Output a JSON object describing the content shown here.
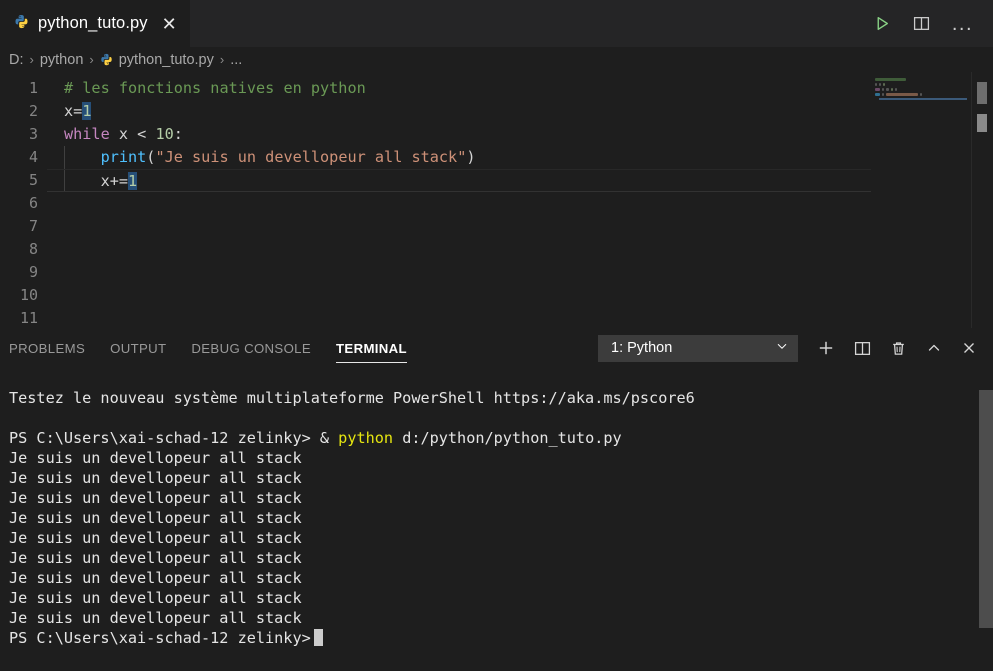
{
  "window": {
    "tab": {
      "label": "python_tuto.py",
      "icon": "python-icon",
      "close_icon": "close-icon"
    },
    "actions": [
      {
        "name": "run-python-file-button",
        "icon": "play-icon",
        "color": "#89d185"
      },
      {
        "name": "split-editor-button",
        "icon": "split-editor-icon",
        "color": "#cccccc"
      },
      {
        "name": "more-actions-button",
        "icon": "ellipsis-icon",
        "label": "..."
      }
    ]
  },
  "breadcrumb": {
    "items": [
      {
        "label": "D:",
        "icon": ""
      },
      {
        "label": "python",
        "icon": ""
      },
      {
        "label": "python_tuto.py",
        "icon": "python-icon"
      },
      {
        "label": "...",
        "icon": ""
      }
    ],
    "separator": "›"
  },
  "editor": {
    "line_numbers": [
      "1",
      "2",
      "3",
      "4",
      "5",
      "6",
      "7",
      "8",
      "9",
      "10",
      "11"
    ],
    "current_line": 5,
    "lines": [
      {
        "n": 1,
        "tokens": [
          {
            "t": "# les fonctions natives en python",
            "c": "cmt"
          }
        ]
      },
      {
        "n": 2,
        "tokens": [
          {
            "t": "x",
            "c": "pun"
          },
          {
            "t": "=",
            "c": "pun"
          },
          {
            "t": "1",
            "c": "num sel-num"
          }
        ]
      },
      {
        "n": 3,
        "tokens": [
          {
            "t": "while",
            "c": "kw"
          },
          {
            "t": " ",
            "c": "pun"
          },
          {
            "t": "x",
            "c": "pun"
          },
          {
            "t": " < ",
            "c": "pun"
          },
          {
            "t": "10",
            "c": "num"
          },
          {
            "t": ":",
            "c": "pun"
          }
        ]
      },
      {
        "n": 4,
        "tokens": [
          {
            "t": "    ",
            "c": "pun"
          },
          {
            "t": "print",
            "c": "fn"
          },
          {
            "t": "(",
            "c": "pun"
          },
          {
            "t": "\"Je suis un devellopeur all stack\"",
            "c": "str"
          },
          {
            "t": ")",
            "c": "pun"
          }
        ]
      },
      {
        "n": 5,
        "tokens": [
          {
            "t": "    ",
            "c": "pun"
          },
          {
            "t": "x",
            "c": "pun"
          },
          {
            "t": "+=",
            "c": "pun"
          },
          {
            "t": "1",
            "c": "num sel-num"
          }
        ]
      },
      {
        "n": 6,
        "tokens": []
      },
      {
        "n": 7,
        "tokens": []
      },
      {
        "n": 8,
        "tokens": []
      },
      {
        "n": 9,
        "tokens": []
      },
      {
        "n": 10,
        "tokens": []
      },
      {
        "n": 11,
        "tokens": []
      }
    ]
  },
  "panel": {
    "tabs": [
      {
        "label": "PROBLEMS",
        "active": false,
        "name": "tab-problems"
      },
      {
        "label": "OUTPUT",
        "active": false,
        "name": "tab-output"
      },
      {
        "label": "DEBUG CONSOLE",
        "active": false,
        "name": "tab-debug-console"
      },
      {
        "label": "TERMINAL",
        "active": true,
        "name": "tab-terminal"
      }
    ],
    "terminal_select": {
      "value": "1: Python",
      "chevron": "chevron-down-icon"
    },
    "icons": [
      {
        "name": "new-terminal-button",
        "icon": "plus-icon"
      },
      {
        "name": "split-terminal-button",
        "icon": "split-icon"
      },
      {
        "name": "kill-terminal-button",
        "icon": "trash-icon"
      },
      {
        "name": "maximize-panel-button",
        "icon": "chevron-up-icon"
      },
      {
        "name": "close-panel-button",
        "icon": "close-icon"
      }
    ]
  },
  "terminal": {
    "lines": [
      {
        "segs": [
          {
            "t": "Testez le nouveau système multiplateforme PowerShell https://aka.ms/pscore6",
            "c": "t-white"
          }
        ]
      },
      {
        "segs": [
          {
            "t": "",
            "c": "t-white"
          }
        ]
      },
      {
        "segs": [
          {
            "t": "PS C:\\Users\\xai-schad-12 zelinky> & ",
            "c": "t-white"
          },
          {
            "t": "python",
            "c": "t-yellow"
          },
          {
            "t": " d:/python/python_tuto.py",
            "c": "t-white"
          }
        ]
      },
      {
        "segs": [
          {
            "t": "Je suis un devellopeur all stack",
            "c": "t-white"
          }
        ]
      },
      {
        "segs": [
          {
            "t": "Je suis un devellopeur all stack",
            "c": "t-white"
          }
        ]
      },
      {
        "segs": [
          {
            "t": "Je suis un devellopeur all stack",
            "c": "t-white"
          }
        ]
      },
      {
        "segs": [
          {
            "t": "Je suis un devellopeur all stack",
            "c": "t-white"
          }
        ]
      },
      {
        "segs": [
          {
            "t": "Je suis un devellopeur all stack",
            "c": "t-white"
          }
        ]
      },
      {
        "segs": [
          {
            "t": "Je suis un devellopeur all stack",
            "c": "t-white"
          }
        ]
      },
      {
        "segs": [
          {
            "t": "Je suis un devellopeur all stack",
            "c": "t-white"
          }
        ]
      },
      {
        "segs": [
          {
            "t": "Je suis un devellopeur all stack",
            "c": "t-white"
          }
        ]
      },
      {
        "segs": [
          {
            "t": "Je suis un devellopeur all stack",
            "c": "t-white"
          }
        ]
      },
      {
        "segs": [
          {
            "t": "PS C:\\Users\\xai-schad-12 zelinky>",
            "c": "t-white"
          }
        ],
        "cursor": true
      }
    ]
  },
  "colors": {
    "editor_bg": "#1e1e1e",
    "tabbar_bg": "#252526",
    "comment": "#6a9955",
    "keyword": "#c586c0",
    "number": "#b5cea8",
    "function": "#4fc1ff",
    "string": "#ce9178",
    "run_green": "#89d185",
    "terminal_yellow": "#e5e510"
  }
}
